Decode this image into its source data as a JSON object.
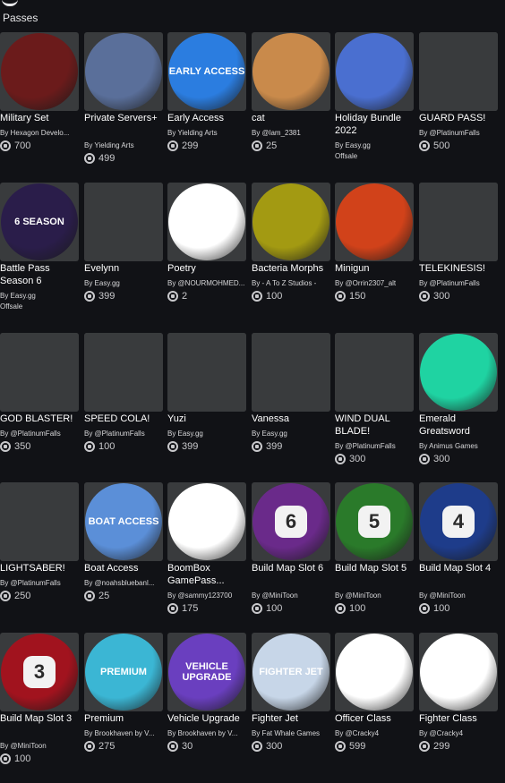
{
  "section": {
    "title": "Passes"
  },
  "colors": {
    "background": "#111216",
    "card": "#393b3d",
    "muted": "#c9c9cc"
  },
  "items": [
    {
      "name": "Military Set",
      "creator": "By Hexagon Develo...",
      "price": "700",
      "bg": "#6b1b1b",
      "icon": "soldier-icon"
    },
    {
      "name": "Private Servers+",
      "creator": "By Yielding Arts",
      "price": "499",
      "bg": "#5a6f9a",
      "icon": "hammer-icon"
    },
    {
      "name": "Early Access",
      "creator": "By Yielding Arts",
      "price": "299",
      "bg": "#2b7de0",
      "icon": "hourglass-icon",
      "art": "EARLY ACCESS"
    },
    {
      "name": "cat",
      "creator": "By @lam_2381",
      "price": "25",
      "bg": "#c98a4b",
      "icon": "cat-icon"
    },
    {
      "name": "Holiday Bundle 2022",
      "creator": "By Easy.gg",
      "price": "",
      "offsale": "Offsale",
      "bg": "#4a6fd0",
      "icon": "holiday-bundle-icon"
    },
    {
      "name": "GUARD PASS!",
      "creator": "By @PlatinumFalls",
      "price": "500",
      "bg": "#393b3d",
      "icon": "guard-icon"
    },
    {
      "name": "Battle Pass Season 6",
      "creator": "By Easy.gg",
      "price": "",
      "offsale": "Offsale",
      "bg": "#2a1d4a",
      "icon": "battle-pass-icon",
      "art": "6 SEASON"
    },
    {
      "name": "Evelynn",
      "creator": "By Easy.gg",
      "price": "399",
      "bg": "#393b3d",
      "icon": "evelynn-icon"
    },
    {
      "name": "Poetry",
      "creator": "By @NOURMOHMED...",
      "price": "2",
      "bg": "#ffffff",
      "icon": "feather-icon"
    },
    {
      "name": "Bacteria Morphs",
      "creator": "By - A To Z Studios -",
      "price": "100",
      "bg": "#a39a12",
      "icon": "bacteria-icon"
    },
    {
      "name": "Minigun",
      "creator": "By @Orrin2307_alt",
      "price": "150",
      "bg": "#d1421a",
      "icon": "minigun-icon"
    },
    {
      "name": "TELEKINESIS!",
      "creator": "By @PlatinumFalls",
      "price": "300",
      "bg": "#393b3d",
      "icon": "telekinesis-icon"
    },
    {
      "name": "GOD BLASTER!",
      "creator": "By @PlatinumFalls",
      "price": "350",
      "bg": "#393b3d",
      "icon": "blaster-icon"
    },
    {
      "name": "SPEED COLA!",
      "creator": "By @PlatinumFalls",
      "price": "100",
      "bg": "#393b3d",
      "icon": "cola-icon"
    },
    {
      "name": "Yuzi",
      "creator": "By Easy.gg",
      "price": "399",
      "bg": "#393b3d",
      "icon": "yuzi-icon"
    },
    {
      "name": "Vanessa",
      "creator": "By Easy.gg",
      "price": "399",
      "bg": "#393b3d",
      "icon": "vanessa-icon"
    },
    {
      "name": "WIND DUAL BLADE!",
      "creator": "By @PlatinumFalls",
      "price": "300",
      "bg": "#393b3d",
      "icon": "blade-icon"
    },
    {
      "name": "Emerald Greatsword",
      "creator": "By Animus Games",
      "price": "300",
      "bg": "#1fd3a2",
      "icon": "sword-icon"
    },
    {
      "name": "LIGHTSABER!",
      "creator": "By @PlatinumFalls",
      "price": "250",
      "bg": "#393b3d",
      "icon": "lightsaber-icon"
    },
    {
      "name": "Boat Access",
      "creator": "By @noahsbluebanl...",
      "price": "25",
      "bg": "#5b8fd8",
      "icon": "boat-icon",
      "art": "BOAT ACCESS"
    },
    {
      "name": "BoomBox GamePass...",
      "creator": "By @sammy123700",
      "price": "175",
      "bg": "#ffffff",
      "icon": "boombox-icon"
    },
    {
      "name": "Build Map Slot 6",
      "creator": "By @MiniToon",
      "price": "100",
      "bg": "#6a2a8a",
      "icon": "slot-6-icon",
      "art": "6"
    },
    {
      "name": "Build Map Slot 5",
      "creator": "By @MiniToon",
      "price": "100",
      "bg": "#2a7a2a",
      "icon": "slot-5-icon",
      "art": "5"
    },
    {
      "name": "Build Map Slot 4",
      "creator": "By @MiniToon",
      "price": "100",
      "bg": "#1e3c8a",
      "icon": "slot-4-icon",
      "art": "4"
    },
    {
      "name": "Build Map Slot 3",
      "creator": "By @MiniToon",
      "price": "100",
      "bg": "#a1131e",
      "icon": "slot-3-icon",
      "art": "3"
    },
    {
      "name": "Premium",
      "creator": "By Brookhaven by V...",
      "price": "275",
      "bg": "#3bb6d4",
      "icon": "star-icon",
      "art": "PREMIUM"
    },
    {
      "name": "Vehicle Upgrade",
      "creator": "By Brookhaven by V...",
      "price": "30",
      "bg": "#6a3fbf",
      "icon": "vehicle-icon",
      "art": "VEHICLE UPGRADE"
    },
    {
      "name": "Fighter Jet",
      "creator": "By Fat Whale Games",
      "price": "300",
      "bg": "#c7d6e8",
      "icon": "jet-icon",
      "art": "FIGHTER JET"
    },
    {
      "name": "Officer Class",
      "creator": "By @Cracky4",
      "price": "599",
      "bg": "#ffffff",
      "icon": "officer-icon"
    },
    {
      "name": "Fighter Class",
      "creator": "By @Cracky4",
      "price": "299",
      "bg": "#ffffff",
      "icon": "fighter-icon"
    }
  ]
}
